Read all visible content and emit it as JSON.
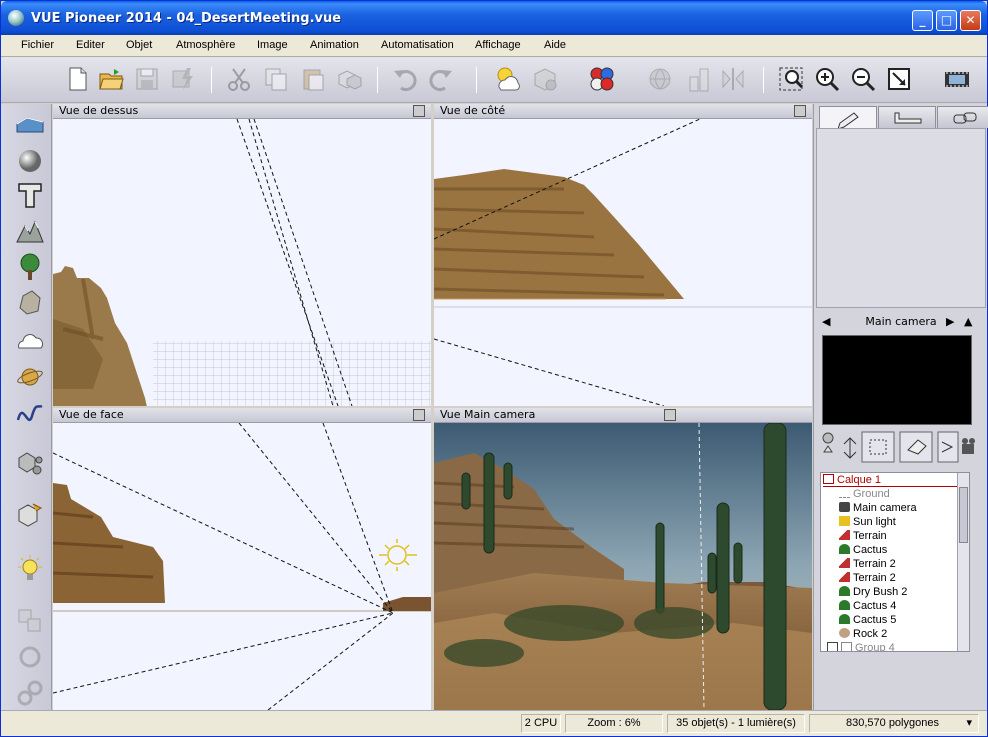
{
  "window": {
    "title": "VUE Pioneer 2014 - 04_DesertMeeting.vue",
    "minimize": "_",
    "maximize": "□",
    "close": "✕"
  },
  "menu": [
    "Fichier",
    "Editer",
    "Objet",
    "Atmosphère",
    "Image",
    "Animation",
    "Automatisation",
    "Affichage",
    "Aide"
  ],
  "toolbar_icons": [
    "new-document-icon",
    "open-folder-icon",
    "save-icon",
    "render-flash-icon",
    "cut-icon",
    "copy-icon",
    "paste-icon",
    "duplicate-icon",
    "undo-icon",
    "redo-icon",
    "atmosphere-icon",
    "material-icon",
    "color-icon",
    "world-browser-icon",
    "bar-icon",
    "mirror-icon",
    "select-area-icon",
    "zoom-in-icon",
    "zoom-out-icon",
    "fit-icon",
    "film-icon"
  ],
  "left_tools": [
    "terrain-plane-icon",
    "sphere-icon",
    "text-icon",
    "mountain-icon",
    "tree-icon",
    "rock-icon",
    "cloud-icon",
    "planet-icon",
    "curve-icon",
    "particles-icon",
    "object-import-icon",
    "light-icon",
    "group-icon",
    "rotate-icon",
    "link-icon"
  ],
  "views": {
    "top": "Vue de dessus",
    "side": "Vue de côté",
    "front": "Vue de face",
    "camera": "Vue Main camera"
  },
  "camera_panel": {
    "title": "Main camera"
  },
  "tree": {
    "layer": "Calque 1",
    "items": [
      {
        "label": "Ground",
        "icon": "ground-icon",
        "dim": true
      },
      {
        "label": "Main camera",
        "icon": "camera-icon",
        "dim": false
      },
      {
        "label": "Sun light",
        "icon": "sun-icon",
        "dim": false
      },
      {
        "label": "Terrain",
        "icon": "terrain-icon",
        "dim": false
      },
      {
        "label": "Cactus",
        "icon": "plant-icon",
        "dim": false
      },
      {
        "label": "Terrain 2",
        "icon": "terrain-icon",
        "dim": false
      },
      {
        "label": "Terrain 2",
        "icon": "terrain-icon",
        "dim": false
      },
      {
        "label": "Dry Bush 2",
        "icon": "plant-icon",
        "dim": false
      },
      {
        "label": "Cactus 4",
        "icon": "plant-icon",
        "dim": false
      },
      {
        "label": "Cactus 5",
        "icon": "plant-icon",
        "dim": false
      },
      {
        "label": "Rock 2",
        "icon": "rock-icon",
        "dim": false
      },
      {
        "label": "Group 4",
        "icon": "group-icon",
        "dim": true
      }
    ]
  },
  "status": {
    "cpu": "2 CPU",
    "zoom": "Zoom : 6%",
    "objects": "35 objet(s) - 1 lumière(s)",
    "polygons": "830,570 polygones"
  },
  "colors": {
    "title_blue": "#1b62e0",
    "view_bg": "#f2f4ff",
    "layer_red": "#b00000"
  }
}
